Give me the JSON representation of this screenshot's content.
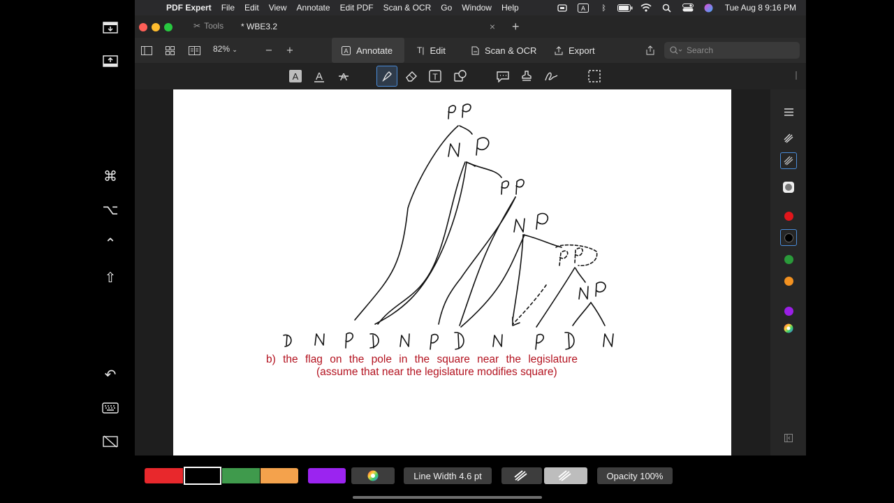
{
  "menubar": {
    "app_name": "PDF Expert",
    "items": [
      "File",
      "Edit",
      "View",
      "Annotate",
      "Edit PDF",
      "Scan & OCR",
      "Go",
      "Window",
      "Help"
    ],
    "clock": "Tue Aug 8  9:16 PM",
    "status_icons": [
      "screen-mirror-icon",
      "input-source-icon",
      "bluetooth-icon",
      "battery-icon",
      "wifi-icon",
      "spotlight-icon",
      "control-center-icon",
      "siri-icon"
    ]
  },
  "tabbar": {
    "tools_label": "Tools",
    "doc_tab_label": "* WBE3.2",
    "new_tab_symbol": "+",
    "close_symbol": "×"
  },
  "toolbar": {
    "zoom": "82%",
    "zoom_out": "−",
    "zoom_in": "+",
    "modes": [
      {
        "label": "Annotate",
        "icon": "annotate-icon",
        "active": true
      },
      {
        "label": "Edit",
        "icon": "text-cursor-icon",
        "active": false
      },
      {
        "label": "Scan & OCR",
        "icon": "scan-icon",
        "active": false
      },
      {
        "label": "Export",
        "icon": "export-icon",
        "active": false
      }
    ],
    "search_placeholder": "Search"
  },
  "annotation_tools": [
    "highlight-text-icon",
    "underline-text-icon",
    "strikethrough-text-icon",
    "pen-icon",
    "eraser-icon",
    "textbox-icon",
    "shapes-icon",
    "comment-icon",
    "stamp-icon",
    "signature-icon",
    "selection-icon"
  ],
  "document": {
    "caption_line1": "b) the flag on the pole in the square near the legislature",
    "caption_line2": "(assume that near the legislature modifies square)",
    "tree_labels": [
      "PP",
      "NP",
      "PP",
      "NP",
      "PP",
      "NP"
    ],
    "leaf_labels": [
      "D",
      "N",
      "P",
      "D",
      "N",
      "P",
      "D",
      "N",
      "P",
      "D",
      "N"
    ]
  },
  "right_panel": {
    "colors": [
      "#e0161b",
      "#000000",
      "#2a9a3a",
      "#f29120",
      "#9a1fe6"
    ]
  },
  "palette": {
    "swatches": [
      "#e8282c",
      "#000000",
      "#3f9a4c",
      "#f4a24c",
      "#9b24f0"
    ],
    "line_width_label": "Line Width 4.6 pt",
    "opacity_label": "Opacity 100%"
  }
}
